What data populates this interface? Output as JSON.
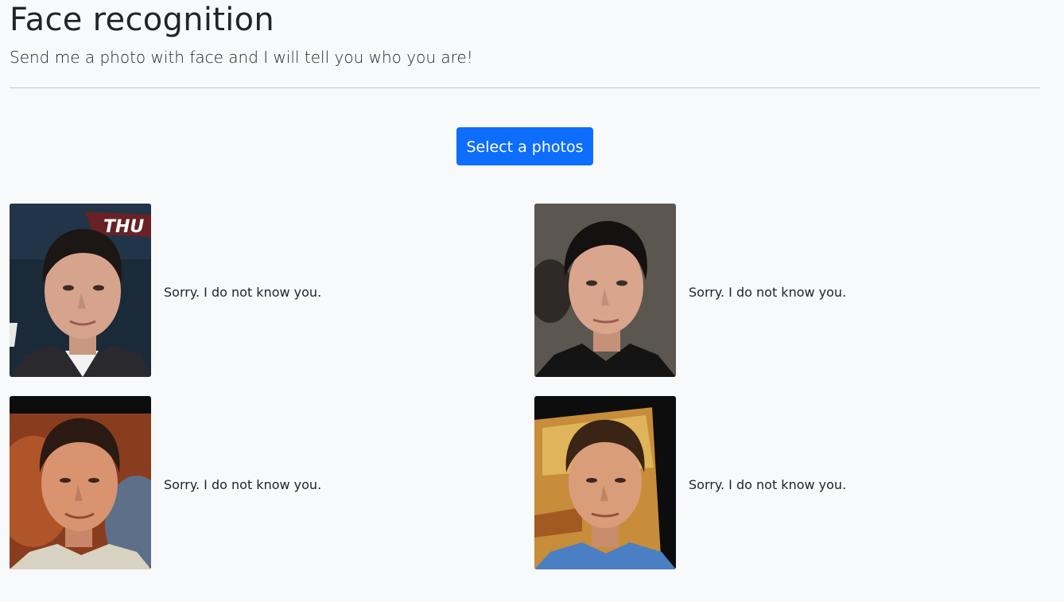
{
  "header": {
    "title": "Face recognition",
    "subtitle": "Send me a photo with face and I will tell you who you are!"
  },
  "upload": {
    "button_label": "Select a photos"
  },
  "results": [
    {
      "photo_icon": "face-photo",
      "message": "Sorry. I do not know you."
    },
    {
      "photo_icon": "face-photo",
      "message": "Sorry. I do not know you."
    },
    {
      "photo_icon": "face-photo",
      "message": "Sorry. I do not know you."
    },
    {
      "photo_icon": "face-photo",
      "message": "Sorry. I do not know you."
    }
  ],
  "colors": {
    "page_background": "#f8f9fa",
    "primary_button": "#0d6efd",
    "text": "#212529"
  }
}
